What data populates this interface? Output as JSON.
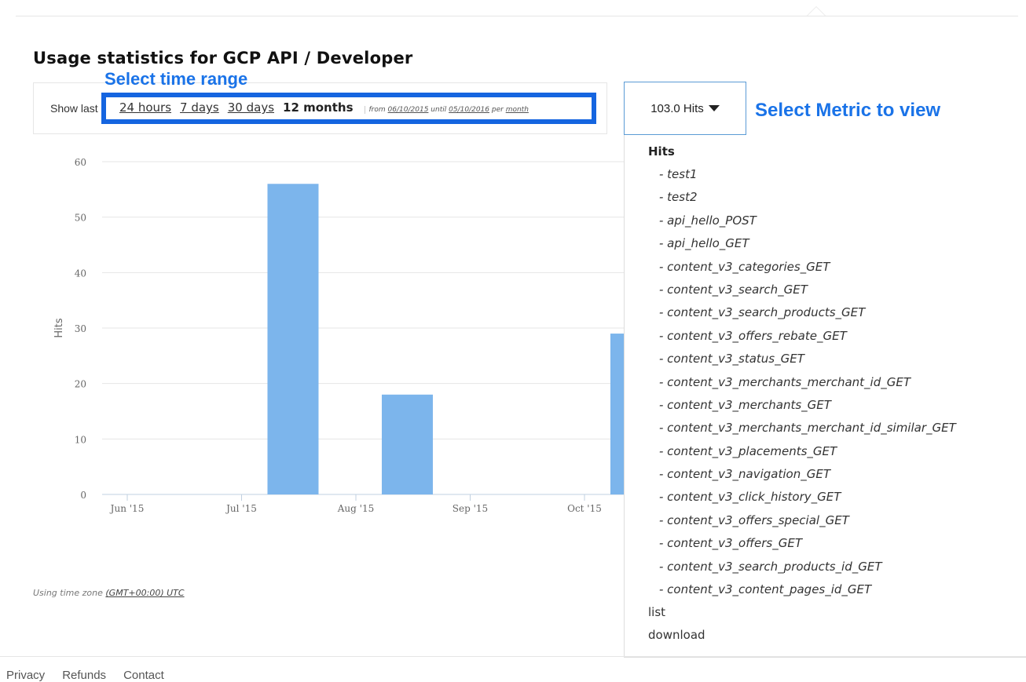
{
  "page": {
    "title": "Usage statistics for GCP API / Developer",
    "timezone_prefix": "Using time zone",
    "timezone_value": "(GMT+00:00) UTC"
  },
  "annotations": {
    "time_range": "Select time range",
    "metric": "Select Metric to view"
  },
  "range": {
    "show_prefix": "Show last",
    "options": [
      "24 hours",
      "7 days",
      "30 days"
    ],
    "active": "12 months",
    "from_label": "from",
    "from_date": "06/10/2015",
    "until_label": "until",
    "until_date": "05/10/2016",
    "per_label": "per",
    "per_value": "month"
  },
  "metric_button": {
    "label": "103.0 Hits"
  },
  "dropdown": {
    "group": "Hits",
    "items": [
      "- test1",
      "- test2",
      "- api_hello_POST",
      "- api_hello_GET",
      "- content_v3_categories_GET",
      "- content_v3_search_GET",
      "- content_v3_search_products_GET",
      "- content_v3_offers_rebate_GET",
      "- content_v3_status_GET",
      "- content_v3_merchants_merchant_id_GET",
      "- content_v3_merchants_GET",
      "- content_v3_merchants_merchant_id_similar_GET",
      "- content_v3_placements_GET",
      "- content_v3_navigation_GET",
      "- content_v3_click_history_GET",
      "- content_v3_offers_special_GET",
      "- content_v3_offers_GET",
      "- content_v3_search_products_id_GET",
      "- content_v3_content_pages_id_GET"
    ],
    "extra": [
      "list",
      "download"
    ]
  },
  "chart_data": {
    "type": "bar",
    "ylabel": "Hits",
    "xlabel": "",
    "ylim": [
      0,
      60
    ],
    "yticks": [
      0,
      10,
      20,
      30,
      40,
      50,
      60
    ],
    "xticks": [
      "Jun '15",
      "Jul '15",
      "Aug '15",
      "Sep '15",
      "Oct '15"
    ],
    "categories": [
      "Jun '15",
      "Jul '15",
      "Aug '15",
      "Sep '15",
      "Oct '15"
    ],
    "values": [
      0,
      56,
      18,
      0,
      29
    ],
    "bar_color": "#7cb5ec",
    "grid": true
  },
  "footer": {
    "links": [
      "Privacy",
      "Refunds",
      "Contact"
    ]
  }
}
